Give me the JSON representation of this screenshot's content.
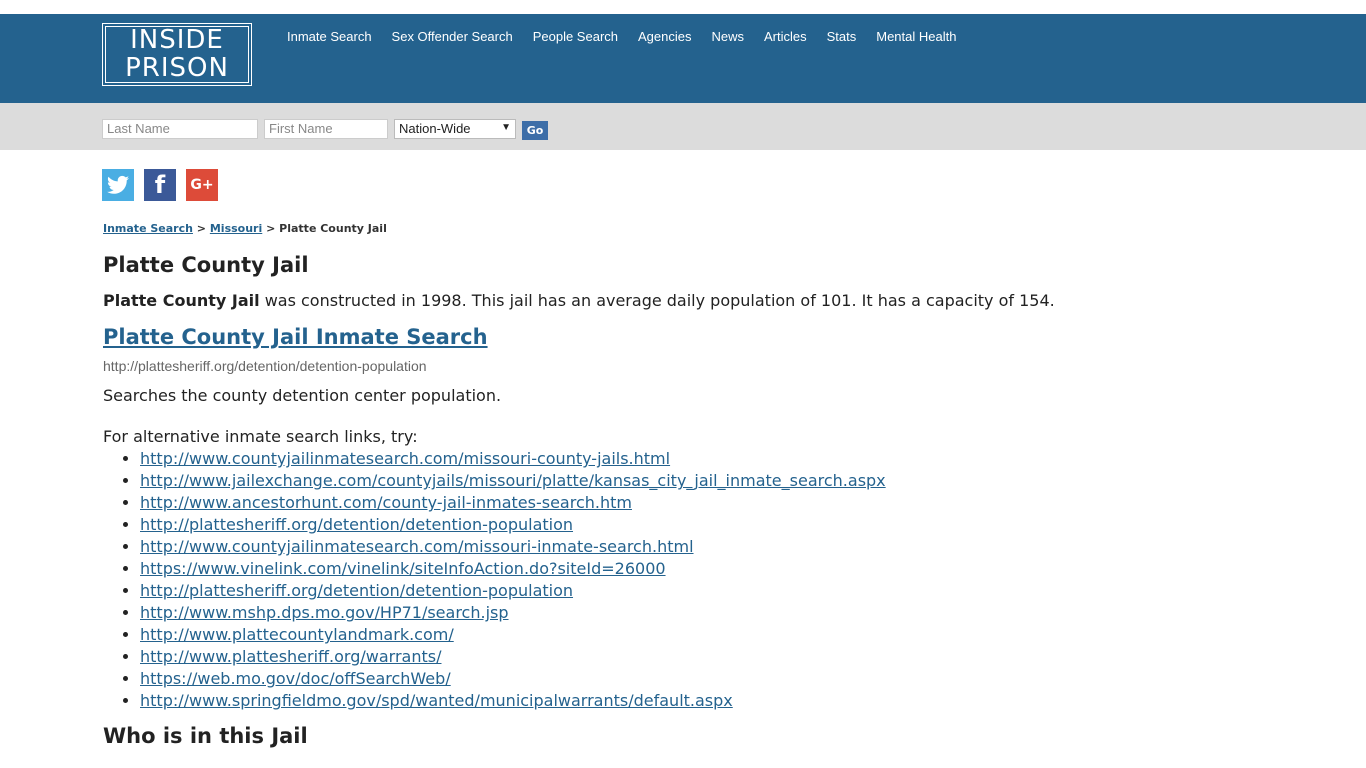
{
  "logo": {
    "line1": "INSIDE",
    "line2": "PRISON"
  },
  "nav": [
    "Inmate Search",
    "Sex Offender Search",
    "People Search",
    "Agencies",
    "News",
    "Articles",
    "Stats",
    "Mental Health"
  ],
  "search": {
    "last_name_placeholder": "Last Name",
    "first_name_placeholder": "First Name",
    "scope_selected": "Nation-Wide",
    "go_label": "Go"
  },
  "social": {
    "twitter": "t",
    "facebook": "f",
    "googleplus": "G+"
  },
  "breadcrumb": {
    "item1": "Inmate Search",
    "sep1": ">",
    "item2": "Missouri",
    "sep2": ">",
    "current": "Platte County Jail"
  },
  "page_title": "Platte County Jail",
  "intro": {
    "bold": "Platte County Jail",
    "text": " was constructed in 1998. This jail has an average daily population of 101. It has a capacity of 154."
  },
  "primary_link": {
    "title": "Platte County Jail Inmate Search",
    "url": "http://plattesheriff.org/detention/detention-population",
    "description": "Searches the county detention center population."
  },
  "alternatives": {
    "intro": "For alternative inmate search links, try:",
    "links": [
      "http://www.countyjailinmatesearch.com/missouri-county-jails.html",
      "http://www.jailexchange.com/countyjails/missouri/platte/kansas_city_jail_inmate_search.aspx",
      "http://www.ancestorhunt.com/county-jail-inmates-search.htm",
      "http://plattesheriff.org/detention/detention-population",
      "http://www.countyjailinmatesearch.com/missouri-inmate-search.html",
      "https://www.vinelink.com/vinelink/siteInfoAction.do?siteId=26000",
      "http://plattesheriff.org/detention/detention-population",
      "http://www.mshp.dps.mo.gov/HP71/search.jsp",
      "http://www.plattecountylandmark.com/",
      "http://www.plattesheriff.org/warrants/",
      "https://web.mo.gov/doc/offSearchWeb/",
      "http://www.springfieldmo.gov/spd/wanted/municipalwarrants/default.aspx"
    ]
  },
  "section_heading": "Who is in this Jail"
}
